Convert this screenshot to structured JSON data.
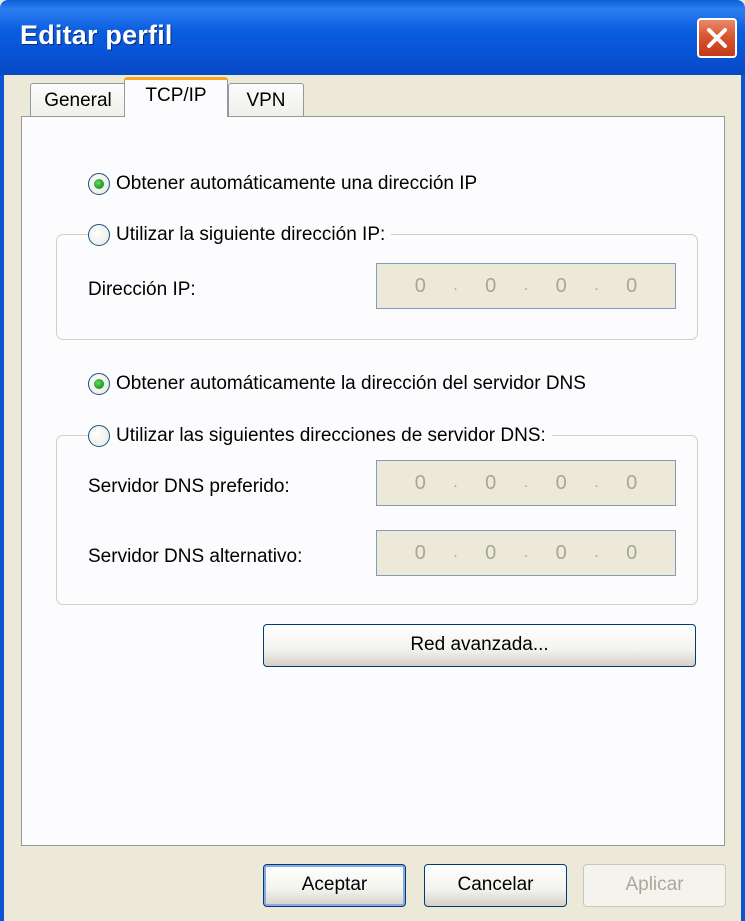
{
  "window": {
    "title": "Editar perfil"
  },
  "tabs": [
    {
      "label": "General"
    },
    {
      "label": "TCP/IP"
    },
    {
      "label": "VPN"
    }
  ],
  "ip": {
    "auto_label": "Obtener automáticamente una dirección IP",
    "manual_label": "Utilizar la siguiente dirección IP:",
    "address_label": "Dirección IP:",
    "address_octets": [
      "0",
      "0",
      "0",
      "0"
    ]
  },
  "dns": {
    "auto_label": "Obtener automáticamente la dirección del servidor DNS",
    "manual_label": "Utilizar las siguientes direcciones de servidor DNS:",
    "preferred_label": "Servidor DNS preferido:",
    "preferred_octets": [
      "0",
      "0",
      "0",
      "0"
    ],
    "alternate_label": "Servidor DNS alternativo:",
    "alternate_octets": [
      "0",
      "0",
      "0",
      "0"
    ]
  },
  "advanced_button": "Red avanzada...",
  "footer": {
    "ok": "Aceptar",
    "cancel": "Cancelar",
    "apply": "Aplicar"
  }
}
